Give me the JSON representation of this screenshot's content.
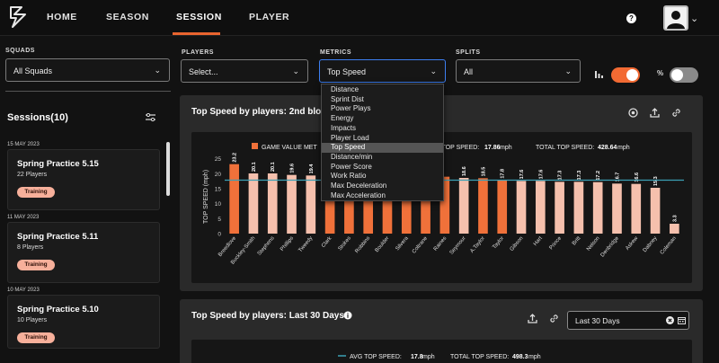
{
  "nav": {
    "tabs": [
      {
        "label": "HOME"
      },
      {
        "label": "SEASON"
      },
      {
        "label": "SESSION"
      },
      {
        "label": "PLAYER"
      }
    ],
    "help_label": "?"
  },
  "filters": {
    "squads": {
      "label": "SQUADS",
      "value": "All Squads"
    },
    "players": {
      "label": "PLAYERS",
      "value": "Select..."
    },
    "metrics": {
      "label": "METRICS",
      "value": "Top Speed"
    },
    "splits": {
      "label": "SPLITS",
      "value": "All"
    },
    "percent_label": "%",
    "bar_toggle_on": true,
    "percent_toggle_on": false
  },
  "sessions": {
    "title": "Sessions(10)",
    "items": [
      {
        "date": "15 MAY 2023",
        "name": "Spring Practice 5.15",
        "players": "22 Players",
        "tag": "Training"
      },
      {
        "date": "11 MAY 2023",
        "name": "Spring Practice 5.11",
        "players": "8 Players",
        "tag": "Training"
      },
      {
        "date": "10 MAY 2023",
        "name": "Spring Practice 5.10",
        "players": "10 Players",
        "tag": "Training"
      }
    ]
  },
  "metrics_dropdown": {
    "options": [
      "Distance",
      "Sprint Dist",
      "Power Plays",
      "Energy",
      "Impacts",
      "Player Load",
      "Top Speed",
      "Distance/min",
      "Power Score",
      "Work Ratio",
      "Max Deceleration",
      "Max Acceleration"
    ],
    "selected": "Top Speed"
  },
  "panel1": {
    "title": "Top Speed by players: 2nd block",
    "legend_game": "GAME VALUE MET",
    "avg_fragment": "S TOP SPEED:",
    "avg_value": "17.86",
    "total_label": "TOTAL TOP SPEED:",
    "total_value": "428.64",
    "unit": "mph"
  },
  "panel2": {
    "title": "Top Speed by players: Last 30 Days",
    "date_range": "Last 30 Days",
    "avg_label": "AVG TOP SPEED:",
    "avg_value": "17.8",
    "total_label": "TOTAL TOP SPEED:",
    "total_value": "498.3",
    "unit": "mph"
  },
  "colors": {
    "accent": "#e9642f",
    "highlight_bar": "#f0713a",
    "normal_bar": "#f5c0ad",
    "avg_line": "#3ba0b5",
    "toggle_on": "#f26a33",
    "toggle_off": "#8a8a8a"
  },
  "chart_data": {
    "type": "bar",
    "ylabel": "TOP SPEED (mph)",
    "ylim": [
      0,
      27
    ],
    "yticks": [
      0,
      5,
      10,
      15,
      20,
      25
    ],
    "avg_line": 17.86,
    "categories": [
      "Breedlove",
      "Buckley-Smith",
      "Stephens",
      "Phillips",
      "Tweedy",
      "Clark",
      "Stokes",
      "Robbins",
      "Boulder",
      "Silvera",
      "Coltrane",
      "Raines",
      "Seymour",
      "A.Taylor",
      "Taylor",
      "Gibson",
      "Hart",
      "Prince",
      "Britt",
      "Nelson",
      "Denbridge",
      "Askew",
      "Dabney",
      "Coleman"
    ],
    "values": [
      23.2,
      20.1,
      20.1,
      19.6,
      19.4,
      19.0,
      19.0,
      19.0,
      19.0,
      19.0,
      19.0,
      19.0,
      18.6,
      18.5,
      17.8,
      17.6,
      17.6,
      17.3,
      17.3,
      17.2,
      16.7,
      16.6,
      15.3,
      3.3
    ],
    "highlight": [
      true,
      false,
      false,
      false,
      false,
      true,
      true,
      true,
      true,
      true,
      true,
      true,
      false,
      true,
      true,
      false,
      false,
      false,
      false,
      false,
      false,
      false,
      false,
      false
    ],
    "value_labels": [
      "23.2",
      "20.1",
      "20.1",
      "19.6",
      "19.4",
      "",
      "",
      "",
      "",
      "",
      "",
      "",
      "18.6",
      "18.5",
      "17.8",
      "17.6",
      "17.6",
      "17.3",
      "17.3",
      "17.2",
      "16.7",
      "16.6",
      "15.3",
      "3.3"
    ]
  }
}
